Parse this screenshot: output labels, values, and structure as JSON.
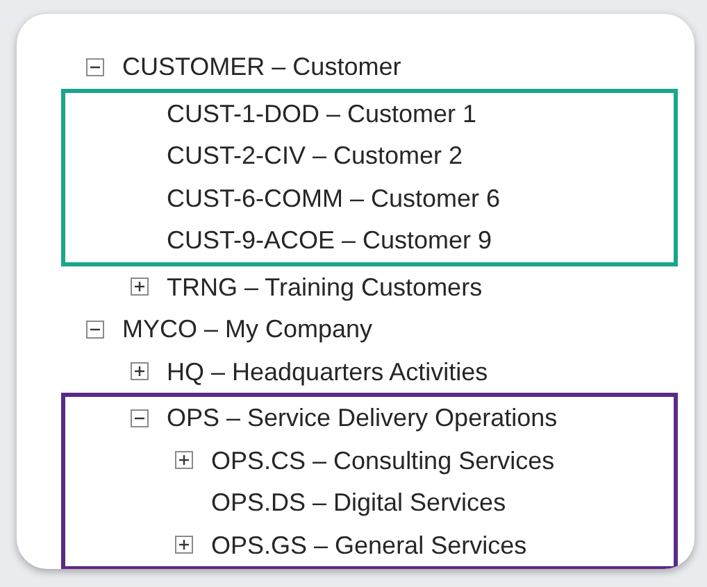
{
  "tree": [
    {
      "kind": "node",
      "label": "CUSTOMER – Customer",
      "expanded": true,
      "children": [
        {
          "kind": "group",
          "color": "#1aa68a",
          "children": [
            {
              "kind": "node",
              "label": "CUST-1-DOD – Customer 1"
            },
            {
              "kind": "node",
              "label": "CUST-2-CIV – Customer 2"
            },
            {
              "kind": "node",
              "label": "CUST-6-COMM – Customer 6"
            },
            {
              "kind": "node",
              "label": "CUST-9-ACOE – Customer 9"
            }
          ]
        },
        {
          "kind": "node",
          "label": "TRNG – Training Customers",
          "expanded": false
        }
      ]
    },
    {
      "kind": "node",
      "label": "MYCO – My Company",
      "expanded": true,
      "children": [
        {
          "kind": "node",
          "label": "HQ – Headquarters Activities",
          "expanded": false
        },
        {
          "kind": "group",
          "color": "#5b2a86",
          "children": [
            {
              "kind": "node",
              "label": "OPS – Service Delivery Operations",
              "expanded": true,
              "children": [
                {
                  "kind": "node",
                  "label": "OPS.CS – Consulting Services",
                  "expanded": false
                },
                {
                  "kind": "node",
                  "label": "OPS.DS – Digital Services"
                },
                {
                  "kind": "node",
                  "label": "OPS.GS – General Services",
                  "expanded": false
                }
              ]
            }
          ]
        }
      ]
    }
  ]
}
